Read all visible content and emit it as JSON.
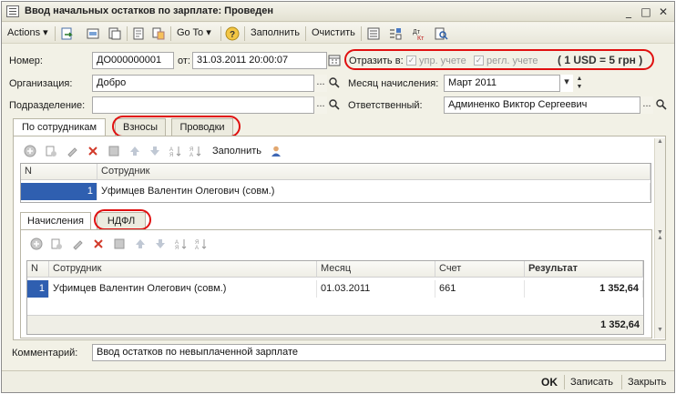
{
  "window": {
    "title": "Ввод начальных остатков по зарплате: Проведен"
  },
  "toolbar": {
    "actions": "Actions",
    "goto": "Go To",
    "fill": "Заполнить",
    "clear": "Очистить"
  },
  "header": {
    "number_label": "Номер:",
    "number_value": "ДО000000001",
    "from_label": "от:",
    "date_value": "31.03.2011 20:00:07",
    "reflect_label": "Отразить в:",
    "mgmt_label": "упр. учете",
    "reg_label": "регл. учете",
    "rate_note": "( 1 USD = 5 грн )",
    "org_label": "Организация:",
    "org_value": "Добро",
    "month_label": "Месяц начисления:",
    "month_value": "Март 2011",
    "dept_label": "Подразделение:",
    "dept_value": "",
    "resp_label": "Ответственный:",
    "resp_value": "Админенко Виктор Сергеевич"
  },
  "tabs": {
    "by_employee": "По сотрудникам",
    "contributions": "Взносы",
    "postings": "Проводки"
  },
  "top_grid": {
    "fill_label": "Заполнить",
    "col_n": "N",
    "col_employee": "Сотрудник",
    "row_n": "1",
    "row_employee": "Уфимцев Валентин Олегович (совм.)"
  },
  "sub_tabs": {
    "accruals": "Начисления",
    "ndfl": "НДФЛ"
  },
  "bottom_grid": {
    "col_n": "N",
    "col_employee": "Сотрудник",
    "col_month": "Месяц",
    "col_account": "Счет",
    "col_result": "Результат",
    "row_n": "1",
    "row_employee": "Уфимцев Валентин Олегович (совм.)",
    "row_month": "01.03.2011",
    "row_account": "661",
    "row_result": "1 352,64",
    "total_result": "1 352,64"
  },
  "comment": {
    "label": "Комментарий:",
    "value": "Ввод остатков по невыплаченной зарплате"
  },
  "footer": {
    "ok": "OK",
    "save": "Записать",
    "close": "Закрыть"
  },
  "colors": {
    "highlight": "#e01010",
    "selection": "#2f5fb0"
  }
}
